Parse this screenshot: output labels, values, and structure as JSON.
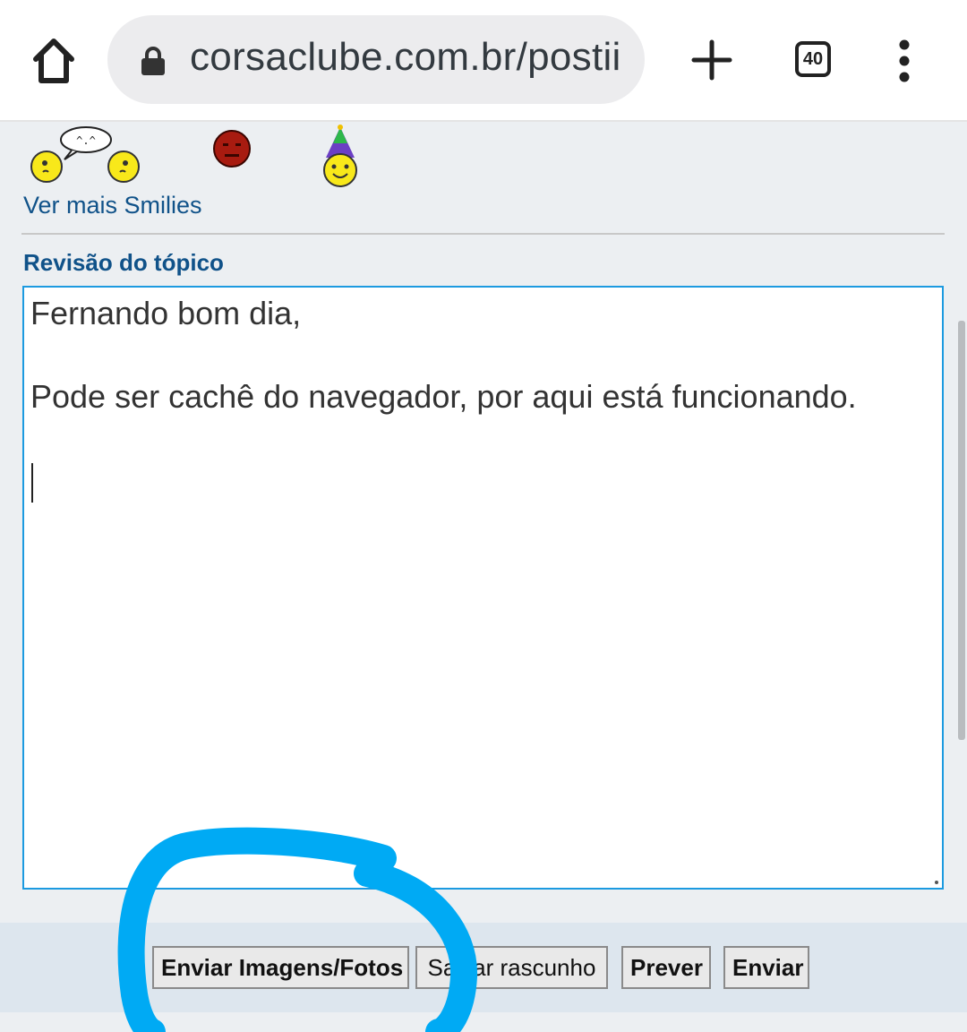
{
  "browser": {
    "url_text": "corsaclube.com.br/postii",
    "tab_count": "40"
  },
  "smilies": {
    "more_label": "Ver mais Smilies",
    "speech_bubble_text": "^.^"
  },
  "review": {
    "title": "Revisão do tópico",
    "lines": [
      "Fernando bom dia,",
      "",
      "Pode ser cachê do navegador, por aqui está funcionando."
    ]
  },
  "buttons": {
    "upload_images": "Enviar Imagens/Fotos",
    "save_draft": "Salvar rascunho",
    "preview": "Prever",
    "submit": "Enviar"
  },
  "colors": {
    "link_blue": "#105289",
    "editor_border": "#1c9ae0",
    "annotation_circle": "#00aaf4"
  }
}
